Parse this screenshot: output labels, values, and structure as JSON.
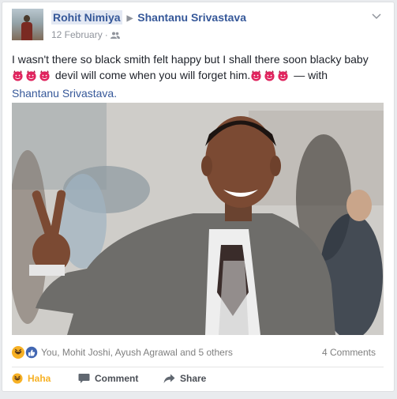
{
  "post": {
    "author": "Rohit Nimiya",
    "tagged": "Shantanu Srivastava",
    "date": "12 February",
    "audience_icon": "friends-icon",
    "text_main": "I wasn't there so black smith felt happy but I shall there soon blacky baby",
    "text_mid": "devil will come when you will forget him.",
    "text_with": "— with",
    "text_tag": "Shantanu Srivastava.",
    "emoji": "smiling-imp"
  },
  "reactions": {
    "reactors": "You, Mohit Joshi, Ayush Agrawal and 5 others",
    "comments": "4 Comments",
    "icons": [
      "haha-icon",
      "like-icon"
    ]
  },
  "actions": {
    "haha": "Haha",
    "comment": "Comment",
    "share": "Share"
  },
  "colors": {
    "link": "#365899",
    "haha": "#f7b125",
    "devil": "#e0245e"
  }
}
